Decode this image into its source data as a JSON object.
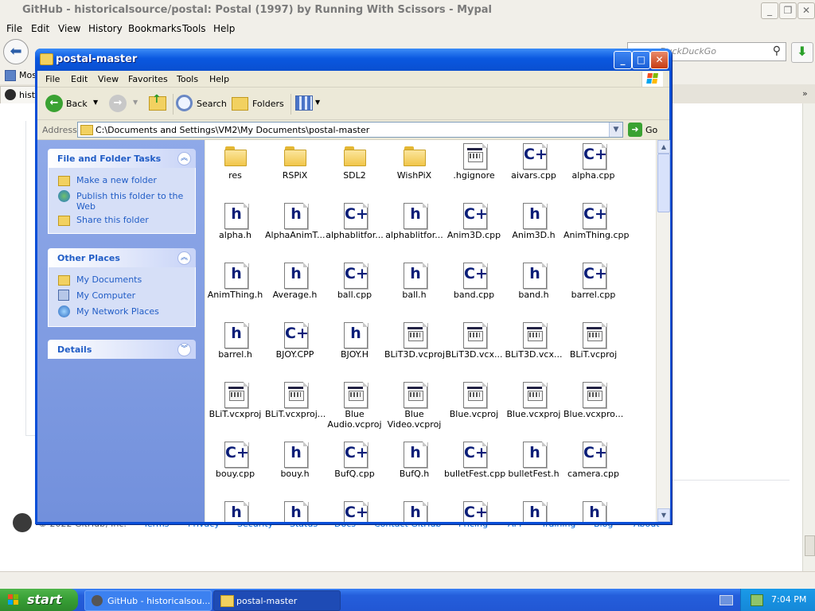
{
  "browser": {
    "title": "GitHub - historicalsource/postal: Postal (1997) by Running With Scissors - Mypal",
    "menu": [
      "File",
      "Edit",
      "View",
      "History",
      "Bookmarks",
      "Tools",
      "Help"
    ],
    "search_placeholder": "DuckDuckGo",
    "bookmarks_item": "Most",
    "tab_label": "histo",
    "footer": {
      "copyright": "© 2022 GitHub, Inc.",
      "links": [
        "Terms",
        "Privacy",
        "Security",
        "Status",
        "Docs",
        "Contact GitHub",
        "Pricing",
        "API",
        "Training",
        "Blog",
        "About"
      ]
    }
  },
  "explorer": {
    "title": "postal-master",
    "menu": [
      "File",
      "Edit",
      "View",
      "Favorites",
      "Tools",
      "Help"
    ],
    "toolbar": {
      "back": "Back",
      "search": "Search",
      "folders": "Folders"
    },
    "address_label": "Address",
    "address_value": "C:\\Documents and Settings\\VM2\\My Documents\\postal-master",
    "go_label": "Go",
    "tasks": {
      "title": "File and Folder Tasks",
      "items": [
        "Make a new folder",
        "Publish this folder to the Web",
        "Share this folder"
      ]
    },
    "places": {
      "title": "Other Places",
      "items": [
        "My Documents",
        "My Computer",
        "My Network Places"
      ]
    },
    "details": {
      "title": "Details"
    },
    "files": [
      {
        "name": "res",
        "type": "folder"
      },
      {
        "name": "RSPiX",
        "type": "folder"
      },
      {
        "name": "SDL2",
        "type": "folder"
      },
      {
        "name": "WishPiX",
        "type": "folder"
      },
      {
        "name": ".hgignore",
        "type": "generic"
      },
      {
        "name": "aivars.cpp",
        "type": "cpp"
      },
      {
        "name": "alpha.cpp",
        "type": "cpp"
      },
      {
        "name": "alpha.h",
        "type": "h"
      },
      {
        "name": "AlphaAnimT...",
        "type": "h"
      },
      {
        "name": "alphablitfor...",
        "type": "cpp"
      },
      {
        "name": "alphablitfor...",
        "type": "h"
      },
      {
        "name": "Anim3D.cpp",
        "type": "cpp"
      },
      {
        "name": "Anim3D.h",
        "type": "h"
      },
      {
        "name": "AnimThing.cpp",
        "type": "cpp"
      },
      {
        "name": "AnimThing.h",
        "type": "h"
      },
      {
        "name": "Average.h",
        "type": "h"
      },
      {
        "name": "ball.cpp",
        "type": "cpp"
      },
      {
        "name": "ball.h",
        "type": "h"
      },
      {
        "name": "band.cpp",
        "type": "cpp"
      },
      {
        "name": "band.h",
        "type": "h"
      },
      {
        "name": "barrel.cpp",
        "type": "cpp"
      },
      {
        "name": "barrel.h",
        "type": "h"
      },
      {
        "name": "BJOY.CPP",
        "type": "cpp"
      },
      {
        "name": "BJOY.H",
        "type": "h"
      },
      {
        "name": "BLiT3D.vcproj",
        "type": "generic"
      },
      {
        "name": "BLiT3D.vcx...",
        "type": "generic"
      },
      {
        "name": "BLiT3D.vcx...",
        "type": "generic"
      },
      {
        "name": "BLiT.vcproj",
        "type": "generic"
      },
      {
        "name": "BLiT.vcxproj",
        "type": "generic"
      },
      {
        "name": "BLiT.vcxproj...",
        "type": "generic"
      },
      {
        "name": "Blue Audio.vcproj",
        "type": "generic"
      },
      {
        "name": "Blue Video.vcproj",
        "type": "generic"
      },
      {
        "name": "Blue.vcproj",
        "type": "generic"
      },
      {
        "name": "Blue.vcxproj",
        "type": "generic"
      },
      {
        "name": "Blue.vcxpro...",
        "type": "generic"
      },
      {
        "name": "bouy.cpp",
        "type": "cpp"
      },
      {
        "name": "bouy.h",
        "type": "h"
      },
      {
        "name": "BufQ.cpp",
        "type": "cpp"
      },
      {
        "name": "BufQ.h",
        "type": "h"
      },
      {
        "name": "bulletFest.cpp",
        "type": "cpp"
      },
      {
        "name": "bulletFest.h",
        "type": "h"
      },
      {
        "name": "camera.cpp",
        "type": "cpp"
      },
      {
        "name": "",
        "type": "h"
      },
      {
        "name": "",
        "type": "h"
      },
      {
        "name": "",
        "type": "cpp"
      },
      {
        "name": "",
        "type": "h"
      },
      {
        "name": "",
        "type": "cpp"
      },
      {
        "name": "",
        "type": "h"
      },
      {
        "name": "",
        "type": "h"
      }
    ]
  },
  "taskbar": {
    "start_label": "start",
    "tasks": [
      "GitHub - historicalsou...",
      "postal-master"
    ],
    "clock": "7:04 PM"
  }
}
